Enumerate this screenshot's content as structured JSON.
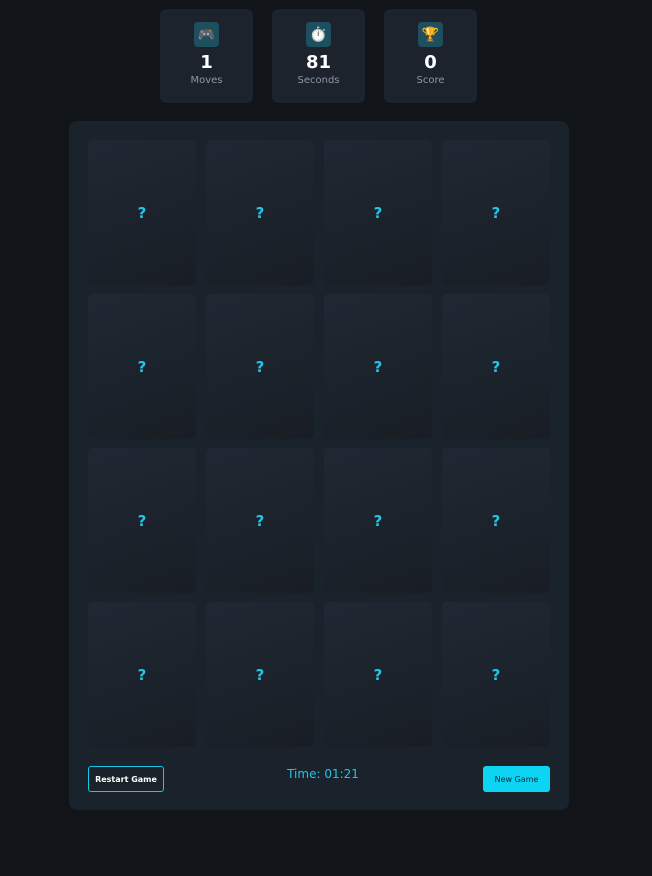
{
  "stats": [
    {
      "icon": "🎮",
      "icon_name": "gamepad-icon",
      "value": "1",
      "label": "Moves"
    },
    {
      "icon": "⏱️",
      "icon_name": "stopwatch-icon",
      "value": "81",
      "label": "Seconds"
    },
    {
      "icon": "🏆",
      "icon_name": "trophy-icon",
      "value": "0",
      "label": "Score"
    }
  ],
  "cards": [
    "?",
    "?",
    "?",
    "?",
    "?",
    "?",
    "?",
    "?",
    "?",
    "?",
    "?",
    "?",
    "?",
    "?",
    "?",
    "?"
  ],
  "controls": {
    "restart_label": "Restart Game",
    "timer_text": "Time: 01:21",
    "new_game_label": "New Game"
  },
  "colors": {
    "background": "#111419",
    "panel": "#1a222b",
    "accent": "#19c7e8"
  }
}
